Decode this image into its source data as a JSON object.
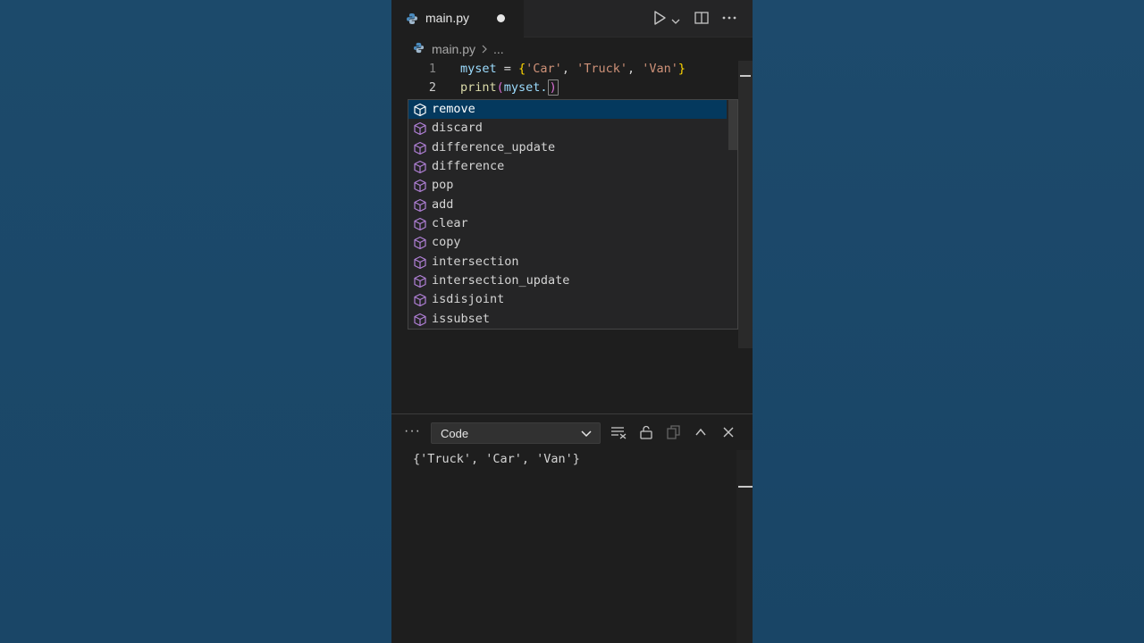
{
  "tab": {
    "filename": "main.py"
  },
  "breadcrumb": {
    "file": "main.py",
    "ellipsis": "..."
  },
  "code": {
    "lines": [
      {
        "number": "1"
      },
      {
        "number": "2"
      }
    ],
    "line1": {
      "var": "myset",
      "op": " = ",
      "open": "{",
      "s1": "'Car'",
      "c1": ", ",
      "s2": "'Truck'",
      "c2": ", ",
      "s3": "'Van'",
      "close": "}"
    },
    "line2": {
      "fn": "print",
      "open": "(",
      "arg": "myset.",
      "close": ")"
    }
  },
  "suggestions": [
    {
      "label": "remove"
    },
    {
      "label": "discard"
    },
    {
      "label": "difference_update"
    },
    {
      "label": "difference"
    },
    {
      "label": "pop"
    },
    {
      "label": "add"
    },
    {
      "label": "clear"
    },
    {
      "label": "copy"
    },
    {
      "label": "intersection"
    },
    {
      "label": "intersection_update"
    },
    {
      "label": "isdisjoint"
    },
    {
      "label": "issubset"
    }
  ],
  "panel": {
    "more": "···",
    "dropdown_value": "Code",
    "output": "{'Truck', 'Car', 'Van'}"
  },
  "colors": {
    "background": "#1b4566",
    "editor": "#1e1e1e",
    "selected_suggestion": "#04395e",
    "method_icon": "#b180d7"
  },
  "icons": {
    "tab": "python-file-icon",
    "run": "play-icon",
    "run_menu": "chevron-down-icon",
    "split": "split-editor-icon",
    "more": "more-actions-icon",
    "suggestion": "method-cube-icon",
    "clear_output": "clear-output-icon",
    "lock": "lock-icon",
    "copy": "copy-icon",
    "maximize": "chevron-up-icon",
    "close": "close-icon"
  }
}
